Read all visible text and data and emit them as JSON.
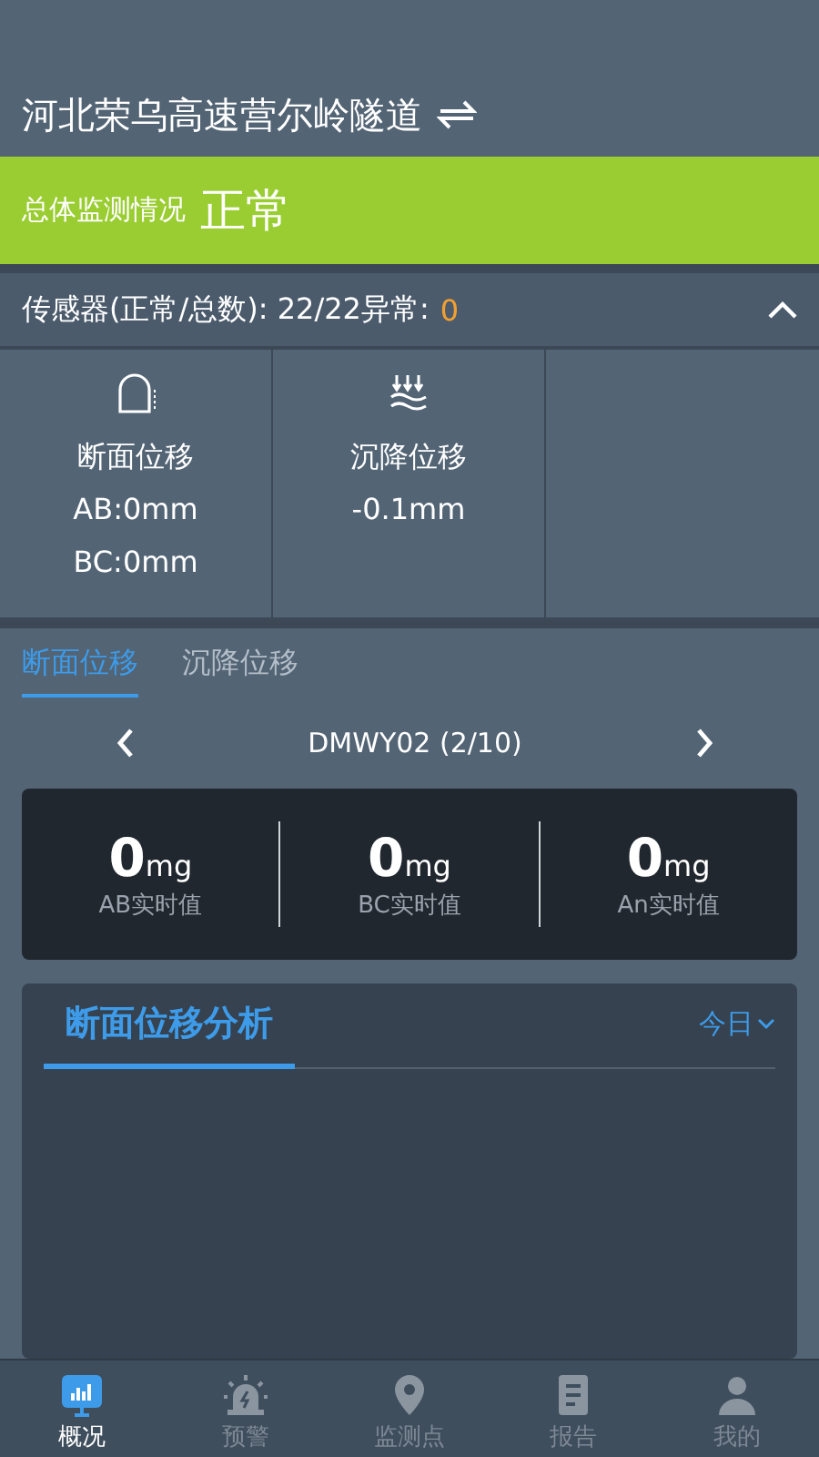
{
  "header": {
    "title": "河北荣乌高速营尔岭隧道"
  },
  "status": {
    "kind": "normal",
    "label": "总体监测情况",
    "value": "正常"
  },
  "sensors": {
    "summary": "传感器(正常/总数): 22/22异常:",
    "abnormal": "0",
    "expanded": true
  },
  "cards": [
    {
      "kind": "tunnel",
      "name": "断面位移",
      "lines": [
        "AB:0mm",
        "BC:0mm"
      ]
    },
    {
      "kind": "settlement",
      "name": "沉降位移",
      "lines": [
        "-0.1mm"
      ]
    }
  ],
  "tabs": [
    {
      "label": "断面位移",
      "selected": true
    },
    {
      "label": "沉降位移",
      "selected": false
    }
  ],
  "pager": {
    "device": "DMWY02 (2/10)"
  },
  "readings": [
    {
      "value": "0",
      "unit": "mg",
      "label": "AB实时值"
    },
    {
      "value": "0",
      "unit": "mg",
      "label": "BC实时值"
    },
    {
      "value": "0",
      "unit": "mg",
      "label": "An实时值"
    }
  ],
  "analysis": {
    "title": "断面位移分析",
    "range": "今日"
  },
  "nav": [
    {
      "kind": "chart",
      "label": "概况",
      "selected": true
    },
    {
      "kind": "alarm",
      "label": "预警",
      "selected": false
    },
    {
      "kind": "pin",
      "label": "监测点",
      "selected": false
    },
    {
      "kind": "report",
      "label": "报告",
      "selected": false
    },
    {
      "kind": "user",
      "label": "我的",
      "selected": false
    }
  ]
}
